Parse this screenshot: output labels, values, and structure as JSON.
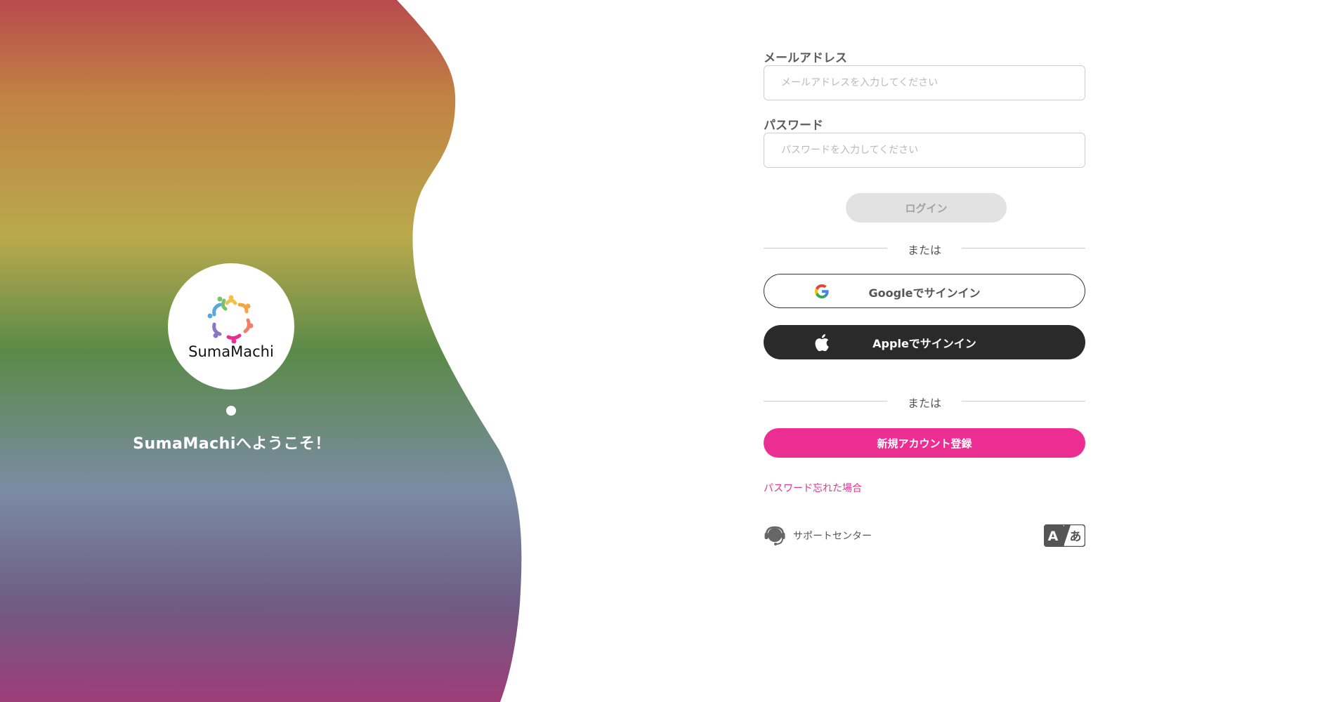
{
  "brand": {
    "logo_text": "SumaMachi",
    "welcome": "SumaMachiへようこそ！"
  },
  "form": {
    "email_label": "メールアドレス",
    "email_placeholder": "メールアドレスを入力してください",
    "email_value": "",
    "password_label": "パスワード",
    "password_placeholder": "パスワードを入力してください",
    "password_value": "",
    "login_label": "ログイン",
    "or_text_1": "または",
    "google_label": "Googleでサインイン",
    "apple_label": "Appleでサインイン",
    "or_text_2": "または",
    "register_label": "新規アカウント登録",
    "forgot_label": "パスワード忘れた場合"
  },
  "footer": {
    "support_label": "サポートセンター",
    "support_icon": "headset-icon",
    "language_icon": "language-toggle-icon"
  },
  "colors": {
    "accent_pink": "#ec2d92",
    "apple_button": "#2a2a2a",
    "login_disabled": "#e2e2e2"
  }
}
